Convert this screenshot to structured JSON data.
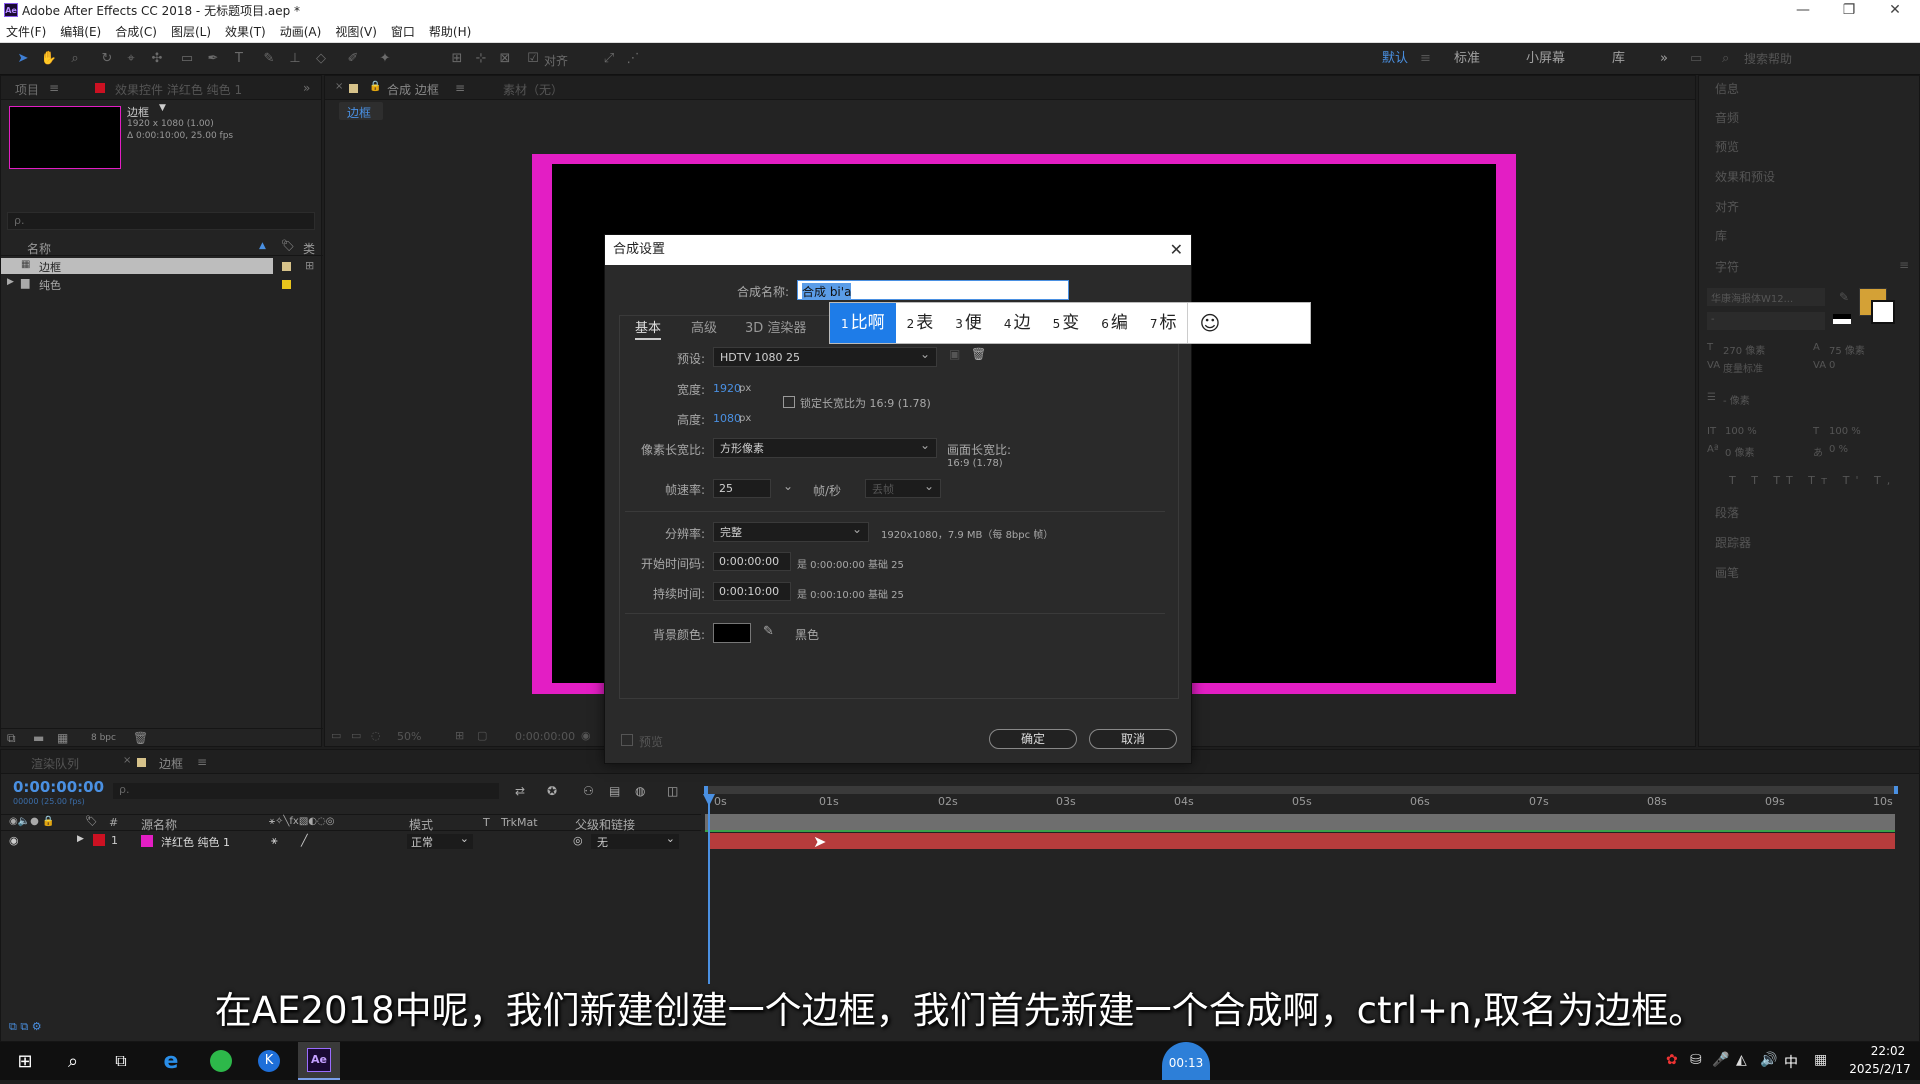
{
  "window": {
    "title": "Adobe After Effects CC 2018 - 无标题项目.aep *",
    "app_icon": "Ae"
  },
  "menu": [
    "文件(F)",
    "编辑(E)",
    "合成(C)",
    "图层(L)",
    "效果(T)",
    "动画(A)",
    "视图(V)",
    "窗口",
    "帮助(H)"
  ],
  "toolbar": {
    "align_label": "对齐",
    "workspaces": [
      "默认",
      "标准",
      "小屏幕",
      "库"
    ],
    "search_placeholder": "搜索帮助"
  },
  "project": {
    "tab_project": "项目",
    "tab_effects": "效果控件 洋红色 纯色 1",
    "thumb_name": "边框",
    "thumb_res": "1920 x 1080 (1.00)",
    "thumb_dur": "Δ 0:00:10:00, 25.00 fps",
    "search_placeholder": "ρ.",
    "col_name": "名称",
    "col_type": "类",
    "items": [
      {
        "name": "边框"
      },
      {
        "name": "纯色"
      }
    ],
    "bpc": "8 bpc"
  },
  "comp": {
    "tab_label": "合成 边框",
    "footage_tab": "素材（无）",
    "breadcrumb": "边框",
    "zoom": "50%",
    "time": "0:00:00:00",
    "frame_color": "#e31ec4"
  },
  "right_panel": {
    "sections": [
      "信息",
      "音频",
      "预览",
      "效果和预设",
      "对齐",
      "库",
      "字符"
    ],
    "lower_sections": [
      "段落",
      "跟踪器",
      "画笔"
    ],
    "font": "华康海报体W12...",
    "font_style": "-",
    "font_size": "270 像素",
    "leading": "75 像素",
    "tracking": "度量标准",
    "kerning": "0",
    "stroke": "- 像素",
    "vscale": "100 %",
    "hscale": "100 %",
    "baseline": "0 像素",
    "tsume": "0 %",
    "fill_color": "#d4a136"
  },
  "timeline": {
    "tab_render": "渲染队列",
    "tab_comp": "边框",
    "timecode": "0:00:00:00",
    "fps_info": "00000 (25.00 fps)",
    "search_placeholder": "ρ.",
    "cols": {
      "num": "#",
      "source": "源名称",
      "mode": "模式",
      "t": "T",
      "trkmat": "TrkMat",
      "parent": "父级和链接"
    },
    "layer": {
      "num": "1",
      "name": "洋红色 纯色 1",
      "mode": "正常",
      "parent": "无",
      "color": "#e31ec4"
    },
    "ticks": [
      "0s",
      "01s",
      "02s",
      "03s",
      "04s",
      "05s",
      "06s",
      "07s",
      "08s",
      "09s",
      "10s"
    ]
  },
  "dialog": {
    "title": "合成设置",
    "name_label": "合成名称:",
    "name_value": "合成 bi'a",
    "tabs": [
      "基本",
      "高级",
      "3D 渲染器"
    ],
    "preset_label": "预设:",
    "preset_value": "HDTV 1080 25",
    "width_label": "宽度:",
    "width_value": "1920",
    "unit_px": "px",
    "height_label": "高度:",
    "height_value": "1080",
    "lock_label": "锁定长宽比为 16:9 (1.78)",
    "par_label": "像素长宽比:",
    "par_value": "方形像素",
    "frame_aspect_label": "画面长宽比:",
    "frame_aspect_value": "16:9 (1.78)",
    "fps_label": "帧速率:",
    "fps_value": "25",
    "fps_unit": "帧/秒",
    "drop_value": "丢帧",
    "res_label": "分辨率:",
    "res_value": "完整",
    "res_info": "1920x1080，7.9 MB（每 8bpc 帧）",
    "start_label": "开始时间码:",
    "start_value": "0:00:00:00",
    "start_info": "是 0:00:00:00  基础 25",
    "dur_label": "持续时间:",
    "dur_value": "0:00:10:00",
    "dur_info": "是 0:00:10:00  基础 25",
    "bg_label": "背景颜色:",
    "bg_color_name": "黑色",
    "preview_label": "预览",
    "ok": "确定",
    "cancel": "取消"
  },
  "ime": {
    "candidates": [
      {
        "n": "1",
        "t": "比啊"
      },
      {
        "n": "2",
        "t": "表"
      },
      {
        "n": "3",
        "t": "便"
      },
      {
        "n": "4",
        "t": "边"
      },
      {
        "n": "5",
        "t": "变"
      },
      {
        "n": "6",
        "t": "编"
      },
      {
        "n": "7",
        "t": "标"
      }
    ]
  },
  "taskbar": {
    "badge": "00:13",
    "time": "22:02",
    "date": "2025/2/17",
    "lang": "中"
  },
  "subtitle": "在AE2018中呢，我们新建创建一个边框，我们首先新建一个合成啊，ctrl+n,取名为边框。"
}
